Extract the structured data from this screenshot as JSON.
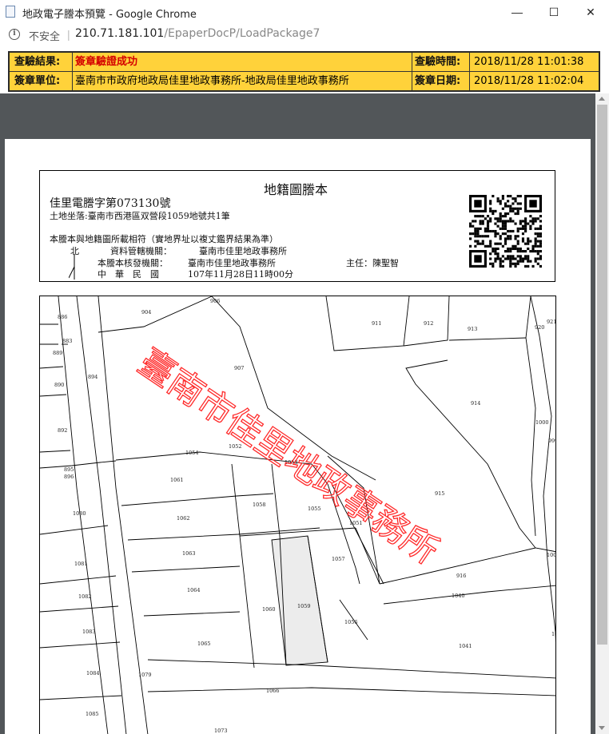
{
  "window": {
    "title": "地政電子謄本預覽 - Google Chrome",
    "minimize_glyph": "—",
    "maximize_glyph": "☐",
    "close_glyph": "✕"
  },
  "address": {
    "info_glyph": "i",
    "security_label": "不安全",
    "separator": "|",
    "host": "210.71.181.101",
    "path": "/EpaperDocP/LoadPackage7"
  },
  "verification": {
    "result_label": "查驗結果:",
    "result_value": "簽章驗證成功",
    "time_label": "查驗時間:",
    "time_value": "2018/11/28 11:01:38",
    "unit_label": "簽章單位:",
    "unit_value": "臺南市市政府地政局佳里地政事務所-地政局佳里地政事務所",
    "date_label": "簽章日期:",
    "date_value": "2018/11/28 11:02:04",
    "colors": {
      "background": "#ffd23a",
      "result_value": "#d40000"
    }
  },
  "document": {
    "title": "地籍圖謄本",
    "doc_number": "佳里電謄字第073130號",
    "location": "土地坐落:臺南市西港區双營段1059地號共1筆",
    "statement": "本謄本與地籍圖所載相符（實地界址以複丈鑑界結果為準）",
    "north": "北",
    "jurisdiction_label": "資料管轄機關：",
    "jurisdiction_value": "臺南市佳里地政事務所",
    "issuer_label": "本謄本核發機關：",
    "issuer_value": "臺南市佳里地政事務所",
    "director": "主任：陳聖智",
    "country": "中　華　民　國",
    "issue_time": "107年11月28日11時00分"
  },
  "map": {
    "stamp_text": "臺南市佳里地政事務所",
    "highlighted_parcel": "1059",
    "parcels": [
      "886",
      "883",
      "889",
      "890",
      "892",
      "895",
      "896",
      "894",
      "904",
      "906",
      "907",
      "911",
      "912",
      "913",
      "920",
      "921",
      "914",
      "1000",
      "999",
      "1054",
      "1052",
      "1053",
      "1061",
      "1080",
      "1062",
      "1058",
      "1055",
      "1051",
      "915",
      "1063",
      "1081",
      "1064",
      "1057",
      "1001",
      "916",
      "1082",
      "1040",
      "1060",
      "1059",
      "1056",
      "1083",
      "1065",
      "1041",
      "1039",
      "1084",
      "1079",
      "1066",
      "1085",
      "1073"
    ]
  }
}
